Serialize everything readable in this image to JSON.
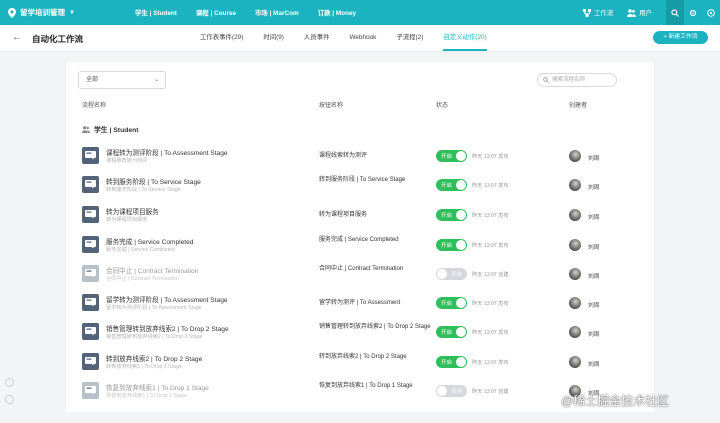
{
  "app": {
    "name": "留学培训管理"
  },
  "top_nav": [
    {
      "label": "学生 | Student"
    },
    {
      "label": "课程 | Course"
    },
    {
      "label": "市场 | MarCom"
    },
    {
      "label": "订款 | Money"
    }
  ],
  "top_right": {
    "workflow": "工作流",
    "users": "用户"
  },
  "page": {
    "title": "自动化工作流",
    "new_button": "+ 新建工作流"
  },
  "tabs": [
    {
      "label": "工作表事件(29)",
      "active": false
    },
    {
      "label": "时间(9)",
      "active": false
    },
    {
      "label": "人员事件",
      "active": false
    },
    {
      "label": "Webhook",
      "active": false
    },
    {
      "label": "子流程(2)",
      "active": false
    },
    {
      "label": "自定义动作(20)",
      "active": true
    }
  ],
  "filter": {
    "value": "全部"
  },
  "search": {
    "placeholder": "搜索流程名称"
  },
  "table": {
    "headers": {
      "name": "流程名称",
      "trigger": "按钮名称",
      "status": "状态",
      "creator": "创建者"
    },
    "group": "学生 | Student",
    "rows": [
      {
        "name": "课程转为测评阶段 | To Assessment Stage",
        "sub": "课程推荐转为测评",
        "trigger": "课程线索转为测评",
        "status": "开启",
        "enabled": true,
        "time": "昨天 13:07 发布",
        "creator": "刘周"
      },
      {
        "name": "转到服务阶段 | To Service Stage",
        "sub": "转到服务阶段 | To Service Stage",
        "trigger": "转到服务阶段 | To Service Stage",
        "status": "开启",
        "enabled": true,
        "time": "昨天 13:07 发布",
        "creator": "刘周"
      },
      {
        "name": "转为课程项目服务",
        "sub": "转为课程项目服务",
        "trigger": "转为课程项目服务",
        "status": "开启",
        "enabled": true,
        "time": "昨天 13:07 发布",
        "creator": "刘周"
      },
      {
        "name": "服务完成 | Service Completed",
        "sub": "服务完成 | Service Completed",
        "trigger": "服务完成 | Service Completed",
        "status": "开启",
        "enabled": true,
        "time": "昨天 13:07 发布",
        "creator": "刘周"
      },
      {
        "name": "合同中止 | Contract Termination",
        "sub": "合同中止 | Contract Termination",
        "trigger": "合同中止 | Contract Termination",
        "status": "开启",
        "enabled": false,
        "time": "昨天 13:07 创建",
        "creator": "刘周"
      },
      {
        "name": "留学转为测评阶段 | To Assessment Stage",
        "sub": "留学转为测评阶段 | To Assessment Stage",
        "trigger": "留学转为测评 | To Assessment",
        "status": "开启",
        "enabled": true,
        "time": "昨天 13:07 发布",
        "creator": "刘周"
      },
      {
        "name": "销售管理转到放弃线索2 | To Drop 2 Stage",
        "sub": "销售管理转到放弃线索2 | To Drop 2 Stage",
        "trigger": "销售管理转到放弃线索2 | To Drop 2 Stage",
        "status": "开启",
        "enabled": true,
        "time": "昨天 13:07 发布",
        "creator": "刘周"
      },
      {
        "name": "转到放弃线索2 | To Drop 2 Stage",
        "sub": "转到放弃线索2 | To Drop 2 Stage",
        "trigger": "转到放弃线索2 | To Drop 2 Stage",
        "status": "开启",
        "enabled": true,
        "time": "昨天 13:07 发布",
        "creator": "刘周"
      },
      {
        "name": "恢复到放弃线索1 | To Drop 1 Stage",
        "sub": "恢复到放弃线索1 | To Drop 1 Stage",
        "trigger": "恢复到放弃线索1 | To Drop 1 Stage",
        "status": "关闭",
        "enabled": false,
        "time": "昨天 13:07 创建",
        "creator": "刘周"
      }
    ]
  },
  "watermark": "@稀土掘金技术社区",
  "colors": {
    "primary": "#1bb3bf",
    "toggle_on": "#2fbf5a",
    "toggle_off": "#d4d7db",
    "icon_bg": "#53647a"
  }
}
